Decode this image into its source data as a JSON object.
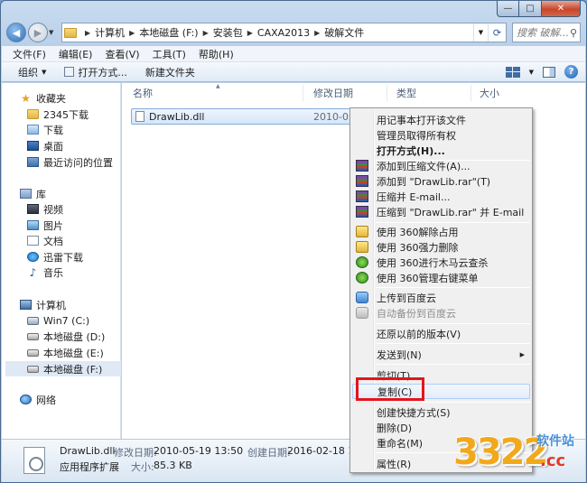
{
  "window": {
    "min_glyph": "—",
    "max_glyph": "□",
    "close_glyph": "✕"
  },
  "address": {
    "crumbs": [
      "计算机",
      "本地磁盘 (F:)",
      "安装包",
      "CAXA2013",
      "破解文件"
    ],
    "search_placeholder": "搜索 破解..."
  },
  "menubar": [
    "文件(F)",
    "编辑(E)",
    "查看(V)",
    "工具(T)",
    "帮助(H)"
  ],
  "toolbar": {
    "organize": "组织",
    "open_with": "打开方式...",
    "new_folder": "新建文件夹"
  },
  "sidebar": {
    "items": [
      {
        "label": "收藏夹",
        "icon": "star-icon"
      },
      {
        "label": "2345下载",
        "icon": "folder-icon"
      },
      {
        "label": "下载",
        "icon": "downloads-folder-icon"
      },
      {
        "label": "桌面",
        "icon": "desktop-icon"
      },
      {
        "label": "最近访问的位置",
        "icon": "recent-places-icon"
      },
      {
        "label": "库",
        "icon": "library-icon"
      },
      {
        "label": "视频",
        "icon": "video-library-icon"
      },
      {
        "label": "图片",
        "icon": "pictures-library-icon"
      },
      {
        "label": "文档",
        "icon": "documents-library-icon"
      },
      {
        "label": "迅雷下载",
        "icon": "thunder-download-icon"
      },
      {
        "label": "音乐",
        "icon": "music-library-icon"
      },
      {
        "label": "计算机",
        "icon": "computer-icon"
      },
      {
        "label": "Win7 (C:)",
        "icon": "system-drive-icon"
      },
      {
        "label": "本地磁盘 (D:)",
        "icon": "drive-icon"
      },
      {
        "label": "本地磁盘 (E:)",
        "icon": "drive-icon"
      },
      {
        "label": "本地磁盘 (F:)",
        "icon": "drive-icon"
      },
      {
        "label": "网络",
        "icon": "network-icon"
      }
    ]
  },
  "columns": {
    "name": "名称",
    "modified": "修改日期",
    "type": "类型",
    "size": "大小"
  },
  "file": {
    "name": "DrawLib.dll",
    "modified": "2010-05-1"
  },
  "details": {
    "name": "DrawLib.dll",
    "type": "应用程序扩展",
    "modified_label": "修改日期:",
    "modified_value": "2010-05-19 13:50",
    "created_label": "创建日期:",
    "created_value": "2016-02-18 16:4",
    "size_label": "大小:",
    "size_value": "85.3 KB"
  },
  "context_menu": {
    "items": [
      {
        "label": "用记事本打开该文件",
        "icon": ""
      },
      {
        "label": "管理员取得所有权",
        "icon": ""
      },
      {
        "label": "打开方式(H)...",
        "icon": ""
      },
      {
        "label": "添加到压缩文件(A)...",
        "icon": "winrar-icon"
      },
      {
        "label": "添加到 \"DrawLib.rar\"(T)",
        "icon": "winrar-icon"
      },
      {
        "label": "压缩并 E-mail...",
        "icon": "winrar-icon"
      },
      {
        "label": "压缩到 \"DrawLib.rar\" 并 E-mail",
        "icon": "winrar-icon"
      },
      {
        "label": "使用 360解除占用",
        "icon": "360-unlock-icon"
      },
      {
        "label": "使用 360强力删除",
        "icon": "360-shred-icon"
      },
      {
        "label": "使用 360进行木马云查杀",
        "icon": "360-scan-icon"
      },
      {
        "label": "使用 360管理右键菜单",
        "icon": "360-menu-icon"
      },
      {
        "label": "上传到百度云",
        "icon": "baidu-cloud-icon"
      },
      {
        "label": "自动备份到百度云",
        "icon": "baidu-backup-icon"
      },
      {
        "label": "还原以前的版本(V)",
        "icon": ""
      },
      {
        "label": "发送到(N)",
        "icon": ""
      },
      {
        "label": "剪切(T)",
        "icon": ""
      },
      {
        "label": "复制(C)",
        "icon": ""
      },
      {
        "label": "创建快捷方式(S)",
        "icon": ""
      },
      {
        "label": "删除(D)",
        "icon": ""
      },
      {
        "label": "重命名(M)",
        "icon": ""
      },
      {
        "label": "属性(R)",
        "icon": ""
      }
    ]
  },
  "watermark": {
    "number": "3322",
    "top": "软件站",
    "domain": ".cc"
  },
  "colors": {
    "highlight_box": "#e3151b",
    "selection": "#d5e6fa",
    "watermark_orange": "#f2a81b"
  }
}
